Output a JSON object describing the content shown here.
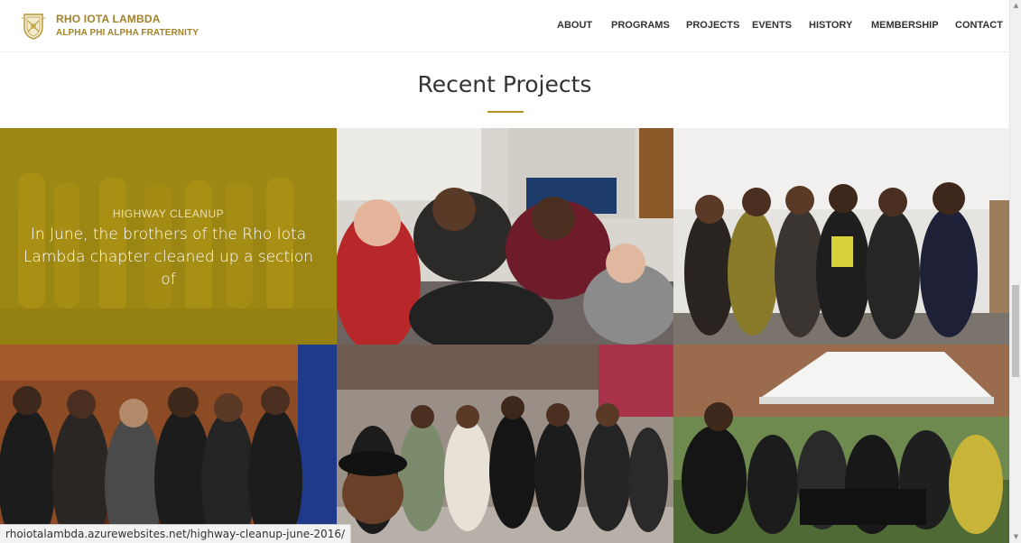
{
  "site": {
    "brand_name": "RHO IOTA LAMBDA",
    "brand_sub": "ALPHA PHI ALPHA FRATERNITY",
    "logo_icon": "fraternity-crest-icon"
  },
  "nav": {
    "items": [
      {
        "label": "ABOUT"
      },
      {
        "label": "PROGRAMS"
      },
      {
        "label": "PROJECTS"
      },
      {
        "label": "EVENTS"
      },
      {
        "label": "HISTORY"
      },
      {
        "label": "MEMBERSHIP"
      },
      {
        "label": "CONTACT"
      }
    ]
  },
  "section": {
    "title": "Recent Projects"
  },
  "projects": {
    "featured": {
      "category": "HIGHWAY CLEANUP",
      "excerpt": "In June, the brothers of the Rho Iota Lambda chapter cleaned up a section of"
    }
  },
  "status": {
    "url": "rhoiotalambda.azurewebsites.net/highway-cleanup-june-2016/"
  },
  "colors": {
    "brand_gold": "#a1822a",
    "overlay_gold": "#a3890e",
    "rule_gold": "#b8932c",
    "nav_text": "#333333"
  }
}
